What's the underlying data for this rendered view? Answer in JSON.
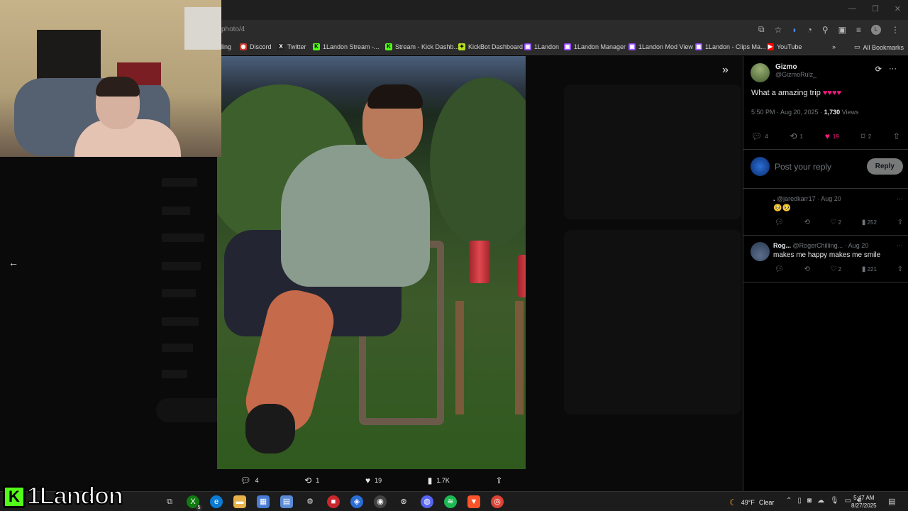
{
  "browser": {
    "url": "photo/4",
    "bookmarks": [
      {
        "label": "ling",
        "color": "#555555",
        "glyph": ""
      },
      {
        "label": "Discord",
        "color": "#c0392b",
        "glyph": "◉"
      },
      {
        "label": "Twitter",
        "color": "#222222",
        "glyph": "X"
      },
      {
        "label": "1Landon Stream -...",
        "color": "#53fc18",
        "glyph": "K"
      },
      {
        "label": "Stream - Kick Dashb...",
        "color": "#53fc18",
        "glyph": "K"
      },
      {
        "label": "KickBot Dashboard",
        "color": "#b6e024",
        "glyph": "✦"
      },
      {
        "label": "1Landon",
        "color": "#9146ff",
        "glyph": "▣"
      },
      {
        "label": "1Landon Manager",
        "color": "#9146ff",
        "glyph": "▣"
      },
      {
        "label": "1Landon Mod View",
        "color": "#9146ff",
        "glyph": "▣"
      },
      {
        "label": "1Landon - Clips Ma...",
        "color": "#9146ff",
        "glyph": "▣"
      },
      {
        "label": "YouTube",
        "color": "#ff0000",
        "glyph": "▶"
      }
    ],
    "more_bookmarks_glyph": "»",
    "all_bookmarks": "All Bookmarks",
    "profile_initial": "L"
  },
  "photo_bar": {
    "replies": "4",
    "reposts": "1",
    "likes": "19",
    "views": "1.7K"
  },
  "tweet": {
    "name": "Gizmo",
    "handle": "@GizmoRulz_",
    "text": "What a amazing trip",
    "hearts": "♥♥♥♥",
    "time": "5:50 PM · Aug 20, 2025 ·",
    "views_count": "1,730",
    "views_label": "Views",
    "replies": "4",
    "reposts": "1",
    "likes": "19",
    "bookmarks": "2"
  },
  "reply_box": {
    "placeholder": "Post your reply",
    "button": "Reply"
  },
  "replies": [
    {
      "name": ".",
      "handle": "@jaredkarr17 · Aug 20",
      "body": "🥺🥺",
      "likes": "2",
      "views": "252"
    },
    {
      "name": "Rog...",
      "handle": "@RogerChilling... · Aug 20",
      "body": "makes me happy makes me smile",
      "likes": "2",
      "views": "221"
    }
  ],
  "taskbar": {
    "temperature": "49°F",
    "condition": "Clear",
    "time": "5:47 AM",
    "date": "8/27/2025",
    "xbox_badge": "5"
  },
  "overlay": {
    "logo_letter": "K",
    "logo_text": "1Landon"
  },
  "colors": {
    "like_pink": "#f91880",
    "kick_green": "#53fc18",
    "background": "#000000",
    "secondary_text": "#71767b"
  }
}
